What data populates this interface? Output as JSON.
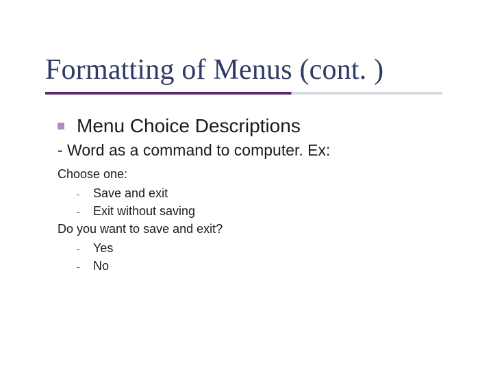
{
  "title": "Formatting of Menus (cont. )",
  "section": {
    "heading": "Menu Choice Descriptions",
    "subheading": "- Word as a command to computer. Ex:",
    "example1": {
      "prompt": "Choose one:",
      "options": [
        "Save and exit",
        "Exit without saving"
      ]
    },
    "example2": {
      "prompt": "Do you want to save and exit?",
      "options": [
        "Yes",
        "No"
      ]
    }
  }
}
